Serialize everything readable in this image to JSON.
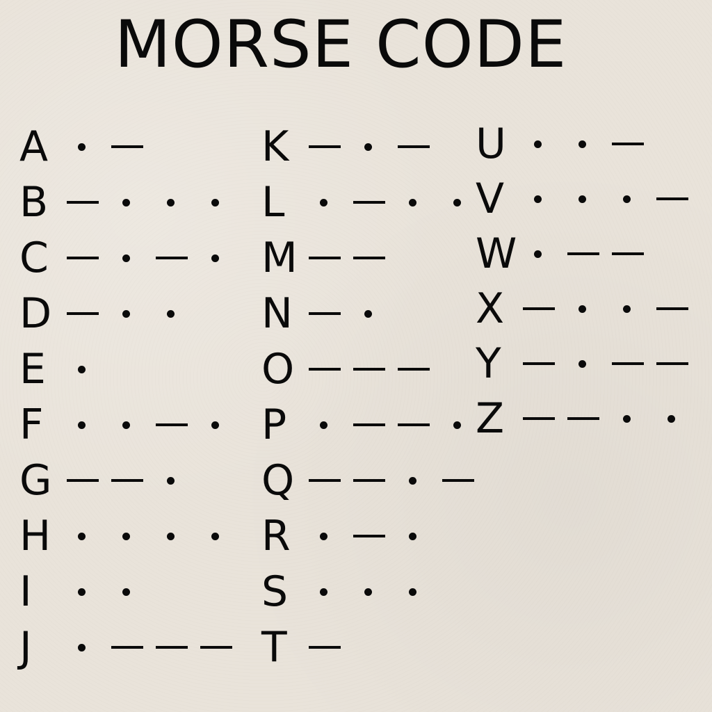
{
  "title": "MORSE CODE",
  "alphabet": [
    {
      "letter": "A",
      "code": ".-"
    },
    {
      "letter": "B",
      "code": "-..."
    },
    {
      "letter": "C",
      "code": "-.-."
    },
    {
      "letter": "D",
      "code": "-.."
    },
    {
      "letter": "E",
      "code": "."
    },
    {
      "letter": "F",
      "code": "..-."
    },
    {
      "letter": "G",
      "code": "--."
    },
    {
      "letter": "H",
      "code": "...."
    },
    {
      "letter": "I",
      "code": ".."
    },
    {
      "letter": "J",
      "code": ".---"
    },
    {
      "letter": "K",
      "code": "-.-"
    },
    {
      "letter": "L",
      "code": ".-.."
    },
    {
      "letter": "M",
      "code": "--"
    },
    {
      "letter": "N",
      "code": "-."
    },
    {
      "letter": "O",
      "code": "---"
    },
    {
      "letter": "P",
      "code": ".--."
    },
    {
      "letter": "Q",
      "code": "--.-"
    },
    {
      "letter": "R",
      "code": ".-."
    },
    {
      "letter": "S",
      "code": "..."
    },
    {
      "letter": "T",
      "code": "-"
    },
    {
      "letter": "U",
      "code": "..-"
    },
    {
      "letter": "V",
      "code": "...-"
    },
    {
      "letter": "W",
      "code": ".--"
    },
    {
      "letter": "X",
      "code": "-..-"
    },
    {
      "letter": "Y",
      "code": "-.--"
    },
    {
      "letter": "Z",
      "code": "--.."
    }
  ],
  "colors": {
    "background": "#e9e3da",
    "ink": "#0a0a0a"
  }
}
